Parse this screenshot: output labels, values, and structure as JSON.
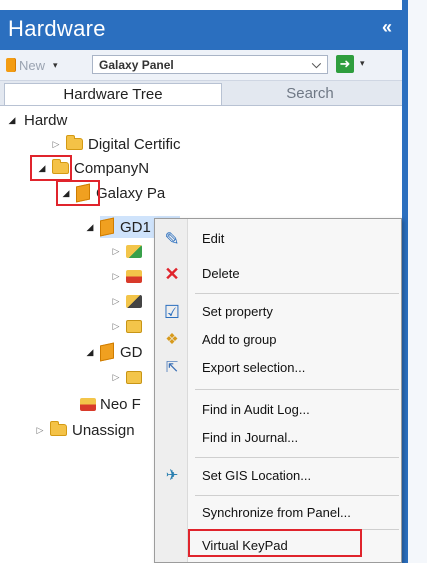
{
  "panel": {
    "title": "Hardware",
    "collapse_glyph": "«"
  },
  "toolbar": {
    "new_label": "New",
    "dropdown_glyph": "▾",
    "panel_combo_value": "Galaxy Panel",
    "combo_arrow": "⌵",
    "go_glyph": "➜"
  },
  "tabs": [
    {
      "label": "Hardware Tree",
      "active": true
    },
    {
      "label": "Search",
      "active": false
    }
  ],
  "tree": {
    "root": "Hardw",
    "digital_cert": "Digital Certific",
    "company": "CompanyN",
    "galaxy_panel": "Galaxy Pa",
    "gd1": "GD1",
    "gd2": "GD",
    "neo": "Neo F",
    "unassigned": "Unassign",
    "toggle_open": "◢",
    "toggle_closed": "▷"
  },
  "context_menu": {
    "edit": "Edit",
    "delete": "Delete",
    "set_property": "Set property",
    "add_to_group": "Add to group",
    "export_selection": "Export selection...",
    "find_audit": "Find in Audit Log...",
    "find_journal": "Find in Journal...",
    "set_gis": "Set GIS Location...",
    "synchronize": "Synchronize from Panel...",
    "virtual_keypad": "Virtual KeyPad"
  },
  "colors": {
    "accent": "#2b6fbf",
    "highlight": "#e0242c"
  }
}
